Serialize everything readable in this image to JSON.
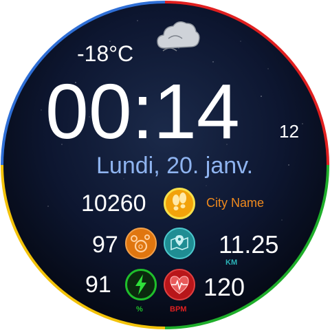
{
  "weather": {
    "temperature": "-18°C",
    "icon": "cloudy-icon"
  },
  "time": {
    "hours_minutes": "00:14",
    "seconds": "12"
  },
  "date": "Lundi, 20. janv.",
  "steps": {
    "value": "10260",
    "icon": "footsteps-icon"
  },
  "location": {
    "label": "City Name"
  },
  "oxygen": {
    "value": "97",
    "icon": "o2-icon",
    "unit": "%"
  },
  "distance": {
    "value": "11.25",
    "unit": "KM",
    "icon": "map-pin-icon"
  },
  "battery": {
    "value": "91",
    "unit": "%",
    "icon": "lightning-icon"
  },
  "heart_rate": {
    "value": "120",
    "unit": "BPM",
    "icon": "heart-icon"
  },
  "colors": {
    "ring_blue": "#2f6fd6",
    "ring_red": "#e02020",
    "ring_yellow": "#f2c20a",
    "ring_green": "#1fae2b",
    "date_blue": "#8fb4f0",
    "accent_orange": "#f08a1d",
    "accent_teal": "#2bb3b8"
  }
}
